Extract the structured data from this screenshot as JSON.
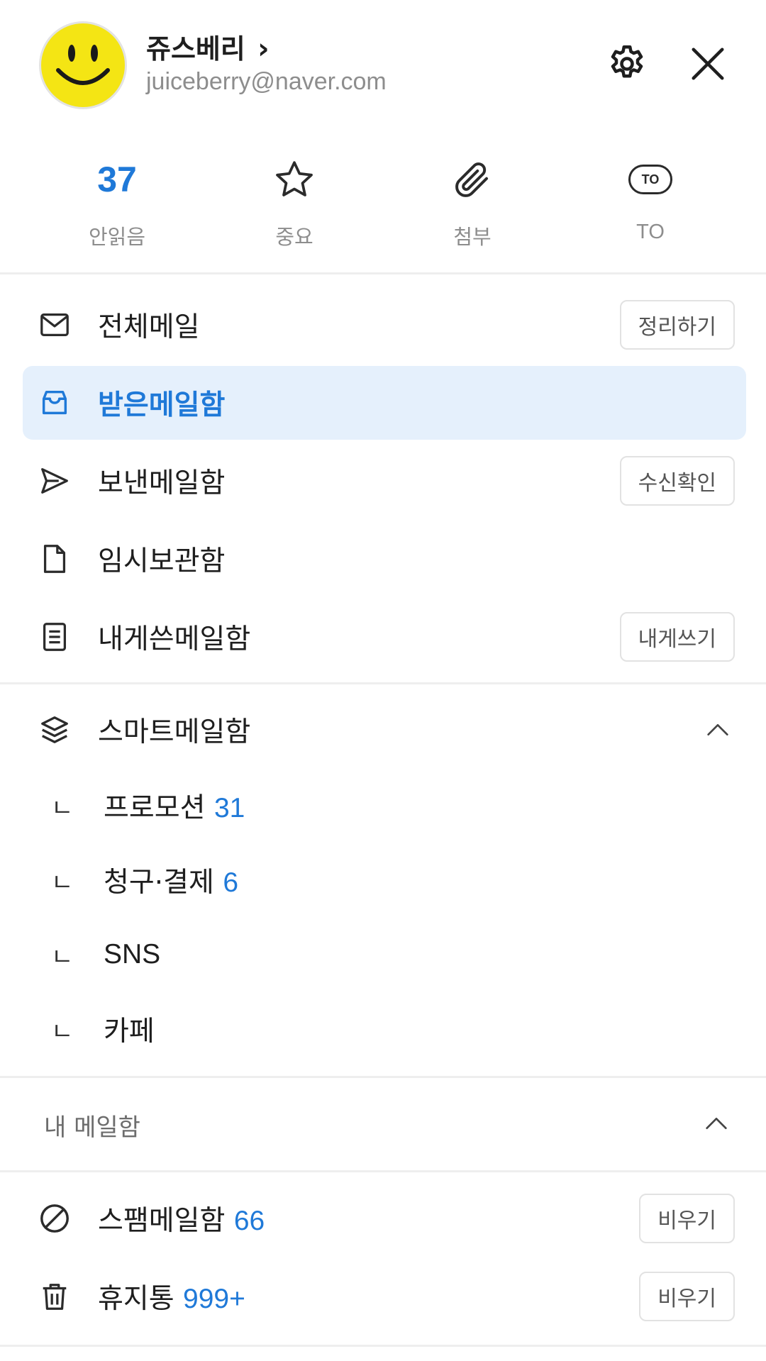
{
  "profile": {
    "name": "쥬스베리",
    "name_chevron": "›",
    "email": "juiceberry@naver.com"
  },
  "header": {
    "settings_icon": "gear-icon",
    "close_icon": "close-icon"
  },
  "stats": [
    {
      "value": "37",
      "label": "안읽음"
    },
    {
      "icon": "star-icon",
      "label": "중요"
    },
    {
      "icon": "paperclip-icon",
      "label": "첨부"
    },
    {
      "icon_text": "TO",
      "label": "TO"
    }
  ],
  "mailboxes": [
    {
      "label": "전체메일",
      "icon": "mail-icon",
      "action": "정리하기"
    },
    {
      "label": "받은메일함",
      "icon": "inbox-icon",
      "active": true
    },
    {
      "label": "보낸메일함",
      "icon": "send-icon",
      "action": "수신확인"
    },
    {
      "label": "임시보관함",
      "icon": "draft-icon"
    },
    {
      "label": "내게쓴메일함",
      "icon": "note-icon",
      "action": "내게쓰기"
    }
  ],
  "smart": {
    "label": "스마트메일함",
    "icon": "layers-icon",
    "corner": "ㄴ",
    "items": [
      {
        "label": "프로모션",
        "count": "31"
      },
      {
        "label": "청구·결제",
        "count": "6"
      },
      {
        "label": "SNS"
      },
      {
        "label": "카페"
      }
    ]
  },
  "my_mailbox": {
    "title": "내 메일함"
  },
  "bottom": [
    {
      "label": "스팸메일함",
      "count": "66",
      "icon": "block-icon",
      "action": "비우기"
    },
    {
      "label": "휴지통",
      "count": "999+",
      "icon": "trash-icon",
      "action": "비우기"
    }
  ],
  "colors": {
    "accent": "#1f79d8",
    "active_bg": "#e5f0fc",
    "avatar_yellow": "#f4e514"
  }
}
